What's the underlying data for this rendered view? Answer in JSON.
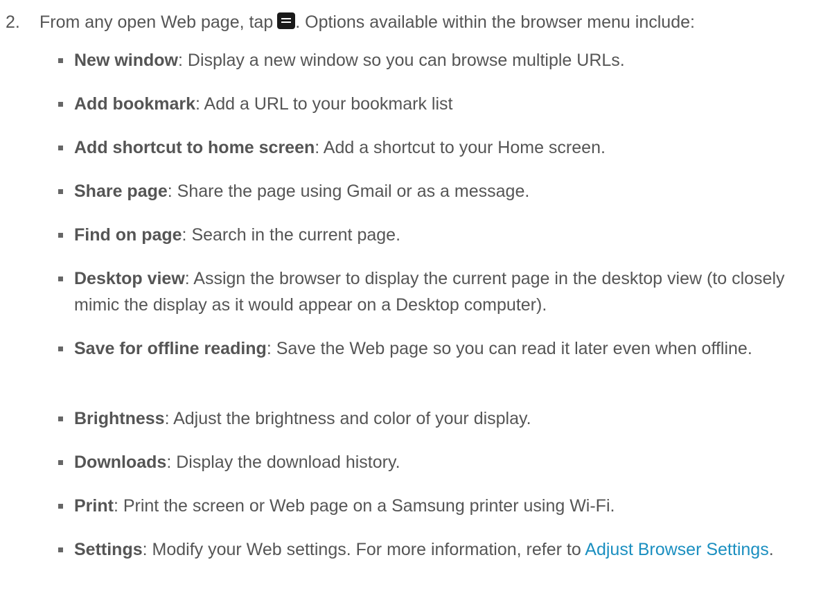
{
  "step": {
    "number": "2.",
    "text_before_icon": "From any open Web page, tap",
    "icon": "menu-key-icon",
    "text_after_icon": ". Options available within the browser menu include:"
  },
  "menu_items": [
    {
      "term": "New window",
      "description": ": Display a new window so you can browse multiple URLs."
    },
    {
      "term": "Add bookmark",
      "description": ": Add a URL to your bookmark list"
    },
    {
      "term": "Add shortcut to home screen",
      "description": ": Add a shortcut to your Home screen."
    },
    {
      "term": "Share page",
      "description": ": Share the page using Gmail or as a message."
    },
    {
      "term": "Find on page",
      "description": ": Search in the current page."
    },
    {
      "term": "Desktop view",
      "description": ": Assign the browser to display the current page in the desktop view (to closely mimic the display as it would appear on a Desktop computer)."
    },
    {
      "term": "Save for offline reading",
      "description": ": Save the Web page so you can read it later even when offline."
    },
    {
      "term": "Brightness",
      "description": ": Adjust the brightness and color of your display."
    },
    {
      "term": "Downloads",
      "description": ": Display the download history."
    },
    {
      "term": "Print",
      "description": ": Print the screen or Web page on a Samsung printer using Wi-Fi."
    },
    {
      "term": "Settings",
      "description": ": Modify your Web settings. For more information, refer to ",
      "link": "Adjust Browser Settings",
      "after_link": "."
    }
  ],
  "colors": {
    "text": "#555555",
    "link": "#1b8fc0",
    "bullet": "#666666"
  }
}
